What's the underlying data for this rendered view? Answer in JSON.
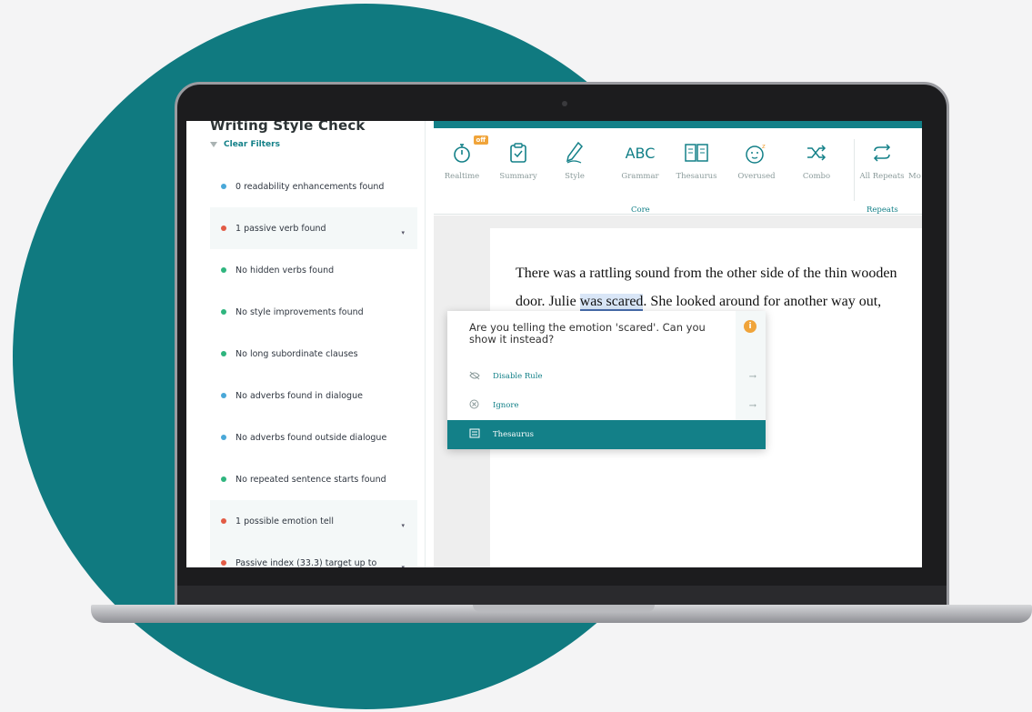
{
  "sidebar": {
    "title": "Writing Style Check",
    "clear_filters": "Clear Filters",
    "items": [
      {
        "label": "0 readability enhancements found",
        "color": "#4aa8d8",
        "expandable": false
      },
      {
        "label": "1 passive verb found",
        "color": "#e25b45",
        "expandable": true
      },
      {
        "label": "No hidden verbs found",
        "color": "#2fb57e",
        "expandable": false
      },
      {
        "label": "No style improvements found",
        "color": "#2fb57e",
        "expandable": false
      },
      {
        "label": "No long subordinate clauses",
        "color": "#2fb57e",
        "expandable": false
      },
      {
        "label": "No adverbs found in dialogue",
        "color": "#4aa8d8",
        "expandable": false
      },
      {
        "label": "No adverbs found outside dialogue",
        "color": "#4aa8d8",
        "expandable": false
      },
      {
        "label": "No repeated sentence starts found",
        "color": "#2fb57e",
        "expandable": false
      },
      {
        "label": "1 possible emotion tell",
        "color": "#e25b45",
        "expandable": true
      },
      {
        "label": "Passive index (33.3) target up to",
        "color": "#e25b45",
        "expandable": true
      }
    ]
  },
  "toolbar": {
    "realtime_badge": "off",
    "tools": [
      {
        "label": "Realtime",
        "icon": "stopwatch-icon"
      },
      {
        "label": "Summary",
        "icon": "clipboard-icon"
      },
      {
        "label": "Style",
        "icon": "pen-icon"
      },
      {
        "label": "Grammar",
        "icon": "abc-check-icon"
      },
      {
        "label": "Thesaurus",
        "icon": "book-icon"
      },
      {
        "label": "Overused",
        "icon": "sleepy-face-icon"
      },
      {
        "label": "Combo",
        "icon": "shuffle-icon"
      },
      {
        "label": "All Repeats",
        "icon": "repeat-icon"
      },
      {
        "label": "Mo",
        "icon": ""
      }
    ],
    "group_core": "Core",
    "group_repeats": "Repeats"
  },
  "document": {
    "before": "There was a rattling sound from the other side of the thin wooden door. Julie ",
    "highlight": "was scared",
    "after": ". She looked around for another way out,"
  },
  "popup": {
    "question": "Are you telling the emotion 'scared'. Can you show it instead?",
    "actions": [
      {
        "label": "Disable Rule",
        "icon": "eye-off-icon"
      },
      {
        "label": "Ignore",
        "icon": "x-circle-icon"
      },
      {
        "label": "Thesaurus",
        "icon": "book-icon"
      }
    ]
  },
  "colors": {
    "teal": "#138088",
    "background_circle": "#107a80",
    "badge": "#f0a43a"
  }
}
